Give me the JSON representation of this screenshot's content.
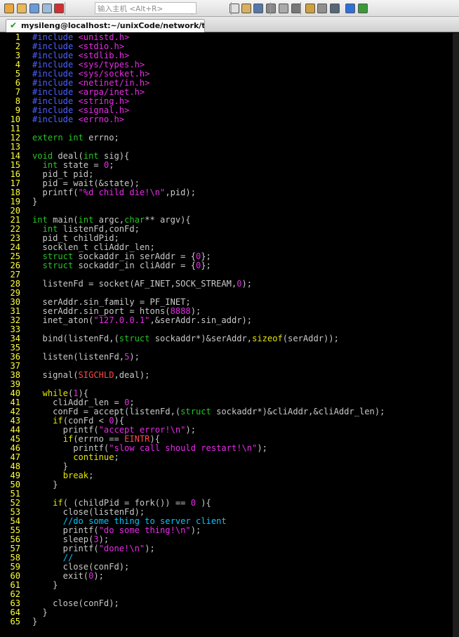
{
  "toolbar": {
    "quick_input_placeholder": "输入主机 <Alt+R>",
    "buttons": [
      {
        "name": "new-session-icon",
        "color": "#e8a83c"
      },
      {
        "name": "open-session-icon",
        "color": "#e8b85a"
      },
      {
        "name": "reconnect-icon",
        "color": "#6a9bd8"
      },
      {
        "name": "connect-all-icon",
        "color": "#9cbcd8"
      },
      {
        "name": "disconnect-icon",
        "color": "#d03030"
      },
      {
        "name": "copy-icon",
        "color": "#e0e0e0"
      },
      {
        "name": "paste-icon",
        "color": "#d8b060"
      },
      {
        "name": "find-icon",
        "color": "#5577aa"
      },
      {
        "name": "print-icon",
        "color": "#888888"
      },
      {
        "name": "print-setup-icon",
        "color": "#aaaaaa"
      },
      {
        "name": "print-screen-icon",
        "color": "#777777"
      },
      {
        "name": "session-options-icon",
        "color": "#d0a040"
      },
      {
        "name": "global-options-icon",
        "color": "#909090"
      },
      {
        "name": "keymap-icon",
        "color": "#556677"
      },
      {
        "name": "help-icon",
        "color": "#2f6fd8"
      },
      {
        "name": "about-icon",
        "color": "#3a9a3a"
      }
    ]
  },
  "tab": {
    "title": "mysileng@localhost:~/unixCode/network/test",
    "status": "✔"
  },
  "editor": {
    "lines": [
      [
        [
          "#include ",
          "p"
        ],
        [
          "<unistd.h>",
          "s"
        ]
      ],
      [
        [
          "#include ",
          "p"
        ],
        [
          "<stdio.h>",
          "s"
        ]
      ],
      [
        [
          "#include ",
          "p"
        ],
        [
          "<stdlib.h>",
          "s"
        ]
      ],
      [
        [
          "#include ",
          "p"
        ],
        [
          "<sys/types.h>",
          "s"
        ]
      ],
      [
        [
          "#include ",
          "p"
        ],
        [
          "<sys/socket.h>",
          "s"
        ]
      ],
      [
        [
          "#include ",
          "p"
        ],
        [
          "<netinet/in.h>",
          "s"
        ]
      ],
      [
        [
          "#include ",
          "p"
        ],
        [
          "<arpa/inet.h>",
          "s"
        ]
      ],
      [
        [
          "#include ",
          "p"
        ],
        [
          "<string.h>",
          "s"
        ]
      ],
      [
        [
          "#include ",
          "p"
        ],
        [
          "<signal.h>",
          "s"
        ]
      ],
      [
        [
          "#include ",
          "p"
        ],
        [
          "<errno.h>",
          "s"
        ]
      ],
      [],
      [
        [
          "extern ",
          "t"
        ],
        [
          "int ",
          "t"
        ],
        [
          "errno;",
          "n"
        ]
      ],
      [],
      [
        [
          "void ",
          "t"
        ],
        [
          "deal(",
          "n"
        ],
        [
          "int ",
          "t"
        ],
        [
          "sig){",
          "n"
        ]
      ],
      [
        [
          "  ",
          "n"
        ],
        [
          "int ",
          "t"
        ],
        [
          "state = ",
          "n"
        ],
        [
          "0",
          "s"
        ],
        [
          ";",
          "n"
        ]
      ],
      [
        [
          "  pid_t pid;",
          "n"
        ]
      ],
      [
        [
          "  pid = wait(&state);",
          "n"
        ]
      ],
      [
        [
          "  printf(",
          "n"
        ],
        [
          "\"%d child die!\\n\"",
          "s"
        ],
        [
          ",pid);",
          "n"
        ]
      ],
      [
        [
          "}",
          "n"
        ]
      ],
      [],
      [
        [
          "int ",
          "t"
        ],
        [
          "main(",
          "n"
        ],
        [
          "int ",
          "t"
        ],
        [
          "argc,",
          "n"
        ],
        [
          "char",
          "t"
        ],
        [
          "** argv){",
          "n"
        ]
      ],
      [
        [
          "  ",
          "n"
        ],
        [
          "int ",
          "t"
        ],
        [
          "listenFd,conFd;",
          "n"
        ]
      ],
      [
        [
          "  pid_t childPid;",
          "n"
        ]
      ],
      [
        [
          "  socklen_t cliAddr_len;",
          "n"
        ]
      ],
      [
        [
          "  ",
          "n"
        ],
        [
          "struct ",
          "t"
        ],
        [
          "sockaddr_in serAddr = {",
          "n"
        ],
        [
          "0",
          "s"
        ],
        [
          "};",
          "n"
        ]
      ],
      [
        [
          "  ",
          "n"
        ],
        [
          "struct ",
          "t"
        ],
        [
          "sockaddr_in cliAddr = {",
          "n"
        ],
        [
          "0",
          "s"
        ],
        [
          "};",
          "n"
        ]
      ],
      [],
      [
        [
          "  listenFd = socket(AF_INET,SOCK_STREAM,",
          "n"
        ],
        [
          "0",
          "s"
        ],
        [
          ");",
          "n"
        ]
      ],
      [],
      [
        [
          "  serAddr.sin_family = PF_INET;",
          "n"
        ]
      ],
      [
        [
          "  serAddr.sin_port = htons(",
          "n"
        ],
        [
          "8888",
          "s"
        ],
        [
          ");",
          "n"
        ]
      ],
      [
        [
          "  inet_aton(",
          "n"
        ],
        [
          "\"127.0.0.1\"",
          "s"
        ],
        [
          ",&serAddr.sin_addr);",
          "n"
        ]
      ],
      [],
      [
        [
          "  bind(listenFd,(",
          "n"
        ],
        [
          "struct ",
          "t"
        ],
        [
          "sockaddr*)&serAddr,",
          "n"
        ],
        [
          "sizeof",
          "k"
        ],
        [
          "(serAddr));",
          "n"
        ]
      ],
      [],
      [
        [
          "  listen(listenFd,",
          "n"
        ],
        [
          "5",
          "s"
        ],
        [
          ");",
          "n"
        ]
      ],
      [],
      [
        [
          "  signal(",
          "n"
        ],
        [
          "SIGCHLD",
          "o"
        ],
        [
          ",deal);",
          "n"
        ]
      ],
      [],
      [
        [
          "  ",
          "n"
        ],
        [
          "while",
          "k"
        ],
        [
          "(",
          "n"
        ],
        [
          "1",
          "s"
        ],
        [
          "){",
          "n"
        ]
      ],
      [
        [
          "    cliAddr_len = ",
          "n"
        ],
        [
          "0",
          "s"
        ],
        [
          ";",
          "n"
        ]
      ],
      [
        [
          "    conFd = accept(listenFd,(",
          "n"
        ],
        [
          "struct ",
          "t"
        ],
        [
          "sockaddr*)&cliAddr,&cliAddr_len);",
          "n"
        ]
      ],
      [
        [
          "    ",
          "n"
        ],
        [
          "if",
          "k"
        ],
        [
          "(conFd < ",
          "n"
        ],
        [
          "0",
          "s"
        ],
        [
          "){",
          "n"
        ]
      ],
      [
        [
          "      printf(",
          "n"
        ],
        [
          "\"accept error!\\n\"",
          "s"
        ],
        [
          ");",
          "n"
        ]
      ],
      [
        [
          "      ",
          "n"
        ],
        [
          "if",
          "k"
        ],
        [
          "(errno == ",
          "n"
        ],
        [
          "EINTR",
          "o"
        ],
        [
          "){",
          "n"
        ]
      ],
      [
        [
          "        printf(",
          "n"
        ],
        [
          "\"slow call should restart!\\n\"",
          "s"
        ],
        [
          ");",
          "n"
        ]
      ],
      [
        [
          "        ",
          "n"
        ],
        [
          "continue",
          "k"
        ],
        [
          ";",
          "n"
        ]
      ],
      [
        [
          "      }",
          "n"
        ]
      ],
      [
        [
          "      ",
          "n"
        ],
        [
          "break",
          "k"
        ],
        [
          ";",
          "n"
        ]
      ],
      [
        [
          "    }",
          "n"
        ]
      ],
      [],
      [
        [
          "    ",
          "n"
        ],
        [
          "if",
          "k"
        ],
        [
          "( (childPid = fork()) == ",
          "n"
        ],
        [
          "0",
          "s"
        ],
        [
          " ){",
          "n"
        ]
      ],
      [
        [
          "      close(listenFd);",
          "n"
        ]
      ],
      [
        [
          "      ",
          "n"
        ],
        [
          "//do some thing to server client",
          "c"
        ]
      ],
      [
        [
          "      printf(",
          "n"
        ],
        [
          "\"do some thing!\\n\"",
          "s"
        ],
        [
          ");",
          "n"
        ]
      ],
      [
        [
          "      sleep(",
          "n"
        ],
        [
          "3",
          "s"
        ],
        [
          ");",
          "n"
        ]
      ],
      [
        [
          "      printf(",
          "n"
        ],
        [
          "\"done!\\n\"",
          "s"
        ],
        [
          ");",
          "n"
        ]
      ],
      [
        [
          "      ",
          "n"
        ],
        [
          "//",
          "c"
        ]
      ],
      [
        [
          "      close(conFd);",
          "n"
        ]
      ],
      [
        [
          "      exit(",
          "n"
        ],
        [
          "0",
          "s"
        ],
        [
          ");",
          "n"
        ]
      ],
      [
        [
          "    }",
          "n"
        ]
      ],
      [],
      [
        [
          "    close(conFd);",
          "n"
        ]
      ],
      [
        [
          "  }",
          "n"
        ]
      ],
      [
        [
          "}",
          "n"
        ]
      ]
    ]
  }
}
